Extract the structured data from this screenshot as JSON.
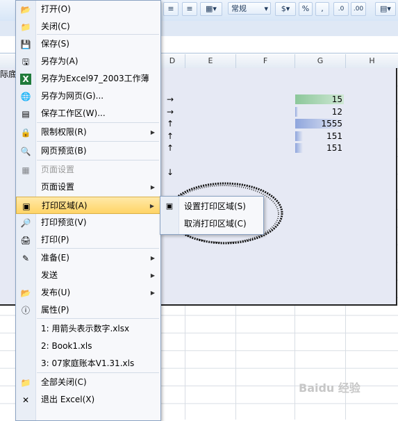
{
  "toolbar": {
    "number_format": "常规",
    "percent_label": "%",
    "comma_label": ","
  },
  "columns": [
    "D",
    "E",
    "F",
    "G",
    "H"
  ],
  "partial_cell_text": "际底",
  "cells_g": [
    "15",
    "12",
    "1555",
    "151",
    "151"
  ],
  "conditional_bar_fractions": [
    0.08,
    0.05,
    1.0,
    0.16,
    0.16
  ],
  "arrows": [
    "→",
    "→",
    "↑",
    "↑",
    "↑",
    "",
    "↓"
  ],
  "menu": {
    "items": [
      {
        "label": "打开(O)",
        "icon": "open-folder-icon"
      },
      {
        "label": "关闭(C)",
        "icon": "close-folder-icon"
      },
      {
        "label": "保存(S)",
        "icon": "save-icon"
      },
      {
        "label": "另存为(A)",
        "icon": "save-as-icon"
      },
      {
        "label": "另存为Excel97_2003工作薄",
        "icon": "excel-icon"
      },
      {
        "label": "另存为网页(G)...",
        "icon": "web-page-icon"
      },
      {
        "label": "保存工作区(W)...",
        "icon": "workspace-icon"
      },
      {
        "label": "限制权限(R)",
        "icon": "permission-icon",
        "submenu": true
      },
      {
        "label": "网页预览(B)",
        "icon": "web-preview-icon"
      },
      {
        "label": "页面设置",
        "icon": "page-setup-icon",
        "disabled": true
      },
      {
        "label": "页面设置",
        "icon": "",
        "submenu": true
      },
      {
        "label": "打印区域(A)",
        "icon": "print-area-icon",
        "submenu": true,
        "highlighted": true
      },
      {
        "label": "打印预览(V)",
        "icon": "print-preview-icon"
      },
      {
        "label": "打印(P)",
        "icon": "printer-icon"
      },
      {
        "label": "准备(E)",
        "icon": "prepare-icon",
        "submenu": true
      },
      {
        "label": "发送",
        "icon": "",
        "submenu": true
      },
      {
        "label": "发布(U)",
        "icon": "publish-icon",
        "submenu": true
      },
      {
        "label": "属性(P)",
        "icon": "properties-icon"
      },
      {
        "label": "1: 用箭头表示数字.xlsx",
        "icon": ""
      },
      {
        "label": "2: Book1.xls",
        "icon": ""
      },
      {
        "label": "3: 07家庭账本V1.31.xls",
        "icon": ""
      },
      {
        "label": "全部关闭(C)",
        "icon": "close-all-icon"
      },
      {
        "label": "退出 Excel(X)",
        "icon": "exit-icon"
      }
    ]
  },
  "submenu": {
    "items": [
      {
        "label": "设置打印区域(S)",
        "icon": "set-print-area-icon"
      },
      {
        "label": "取消打印区域(C)",
        "icon": ""
      }
    ]
  },
  "colors": {
    "accent_green": "#8cc79a",
    "bar_blue": "#8fa6dd",
    "highlight": "#ffd466"
  }
}
